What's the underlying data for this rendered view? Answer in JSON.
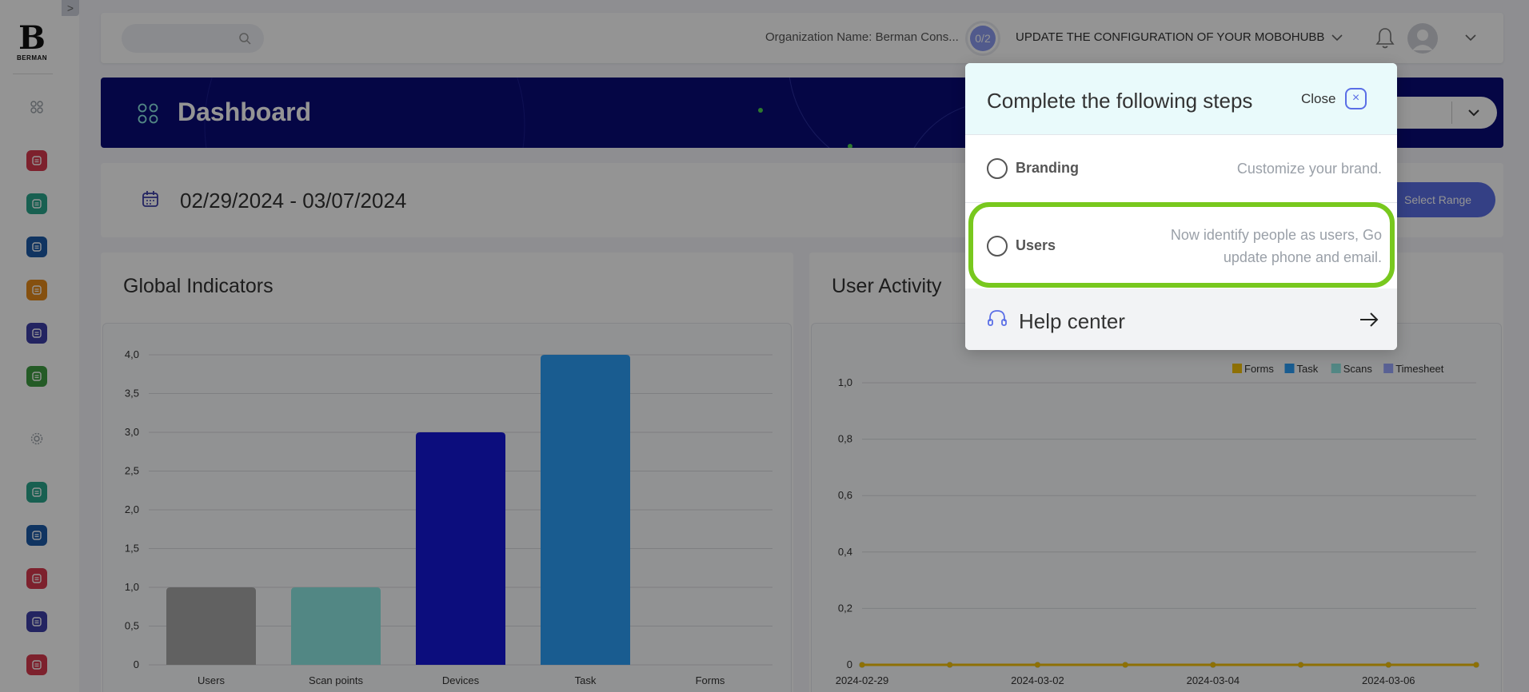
{
  "sidebar": {
    "logo_text": "BERMAN",
    "toggle_glyph": ">",
    "icons": [
      {
        "name": "dashboard-grid-icon",
        "color": "#9aa0a8"
      },
      {
        "name": "scan-icon",
        "color": "#d83a4e"
      },
      {
        "name": "location-pin-icon",
        "color": "#2aa58c"
      },
      {
        "name": "document-list-icon",
        "color": "#1d5aa8"
      },
      {
        "name": "alert-icon",
        "color": "#e58a1a"
      },
      {
        "name": "tablet-device-icon",
        "color": "#3d3ea8"
      },
      {
        "name": "map-icon",
        "color": "#3e9e42"
      },
      {
        "name": "settings-gear-icon",
        "color": "#9aa0a8"
      },
      {
        "name": "shield-icon",
        "color": "#2aa58c"
      },
      {
        "name": "cast-screen-icon",
        "color": "#1d5aa8"
      },
      {
        "name": "users-group-icon",
        "color": "#d83a4e"
      },
      {
        "name": "gallery-icon",
        "color": "#3d3ea8"
      },
      {
        "name": "form-list-icon",
        "color": "#d83a4e"
      }
    ]
  },
  "topbar": {
    "search_placeholder": "",
    "organization": "Organization Name: Berman Cons...",
    "progress_badge": "0/2",
    "update_text": "UPDATE THE CONFIGURATION OF YOUR MOBOHUBB"
  },
  "banner": {
    "title": "Dashboard"
  },
  "datebar": {
    "range": "02/29/2024 - 03/07/2024",
    "select_range_label": "Select Range"
  },
  "global_indicators": {
    "title": "Global Indicators"
  },
  "user_activity": {
    "title": "User Activity"
  },
  "chart_data": [
    {
      "type": "bar",
      "title": "Global Indicators",
      "categories": [
        "Users",
        "Scan points",
        "Devices",
        "Task",
        "Forms"
      ],
      "values": [
        1,
        1,
        3,
        4,
        0
      ],
      "colors": [
        "#a8a8a8",
        "#8ee8e4",
        "#1618d8",
        "#2b9ff8",
        "#cccccc"
      ],
      "ylim": [
        0,
        4
      ],
      "yticks": [
        "0",
        "0,5",
        "1,0",
        "1,5",
        "2,0",
        "2,5",
        "3,0",
        "3,5",
        "4,0"
      ],
      "grid": true
    },
    {
      "type": "line",
      "title": "User Activity",
      "x": [
        "2024-02-29",
        "2024-03-01",
        "2024-03-02",
        "2024-03-03",
        "2024-03-04",
        "2024-03-05",
        "2024-03-06",
        "2024-03-07"
      ],
      "xtick_labels": [
        "2024-02-29",
        "2024-03-02",
        "2024-03-04",
        "2024-03-06"
      ],
      "series": [
        {
          "name": "Forms",
          "color": "#f5c20a",
          "values": [
            0,
            0,
            0,
            0,
            0,
            0,
            0,
            0
          ]
        },
        {
          "name": "Task",
          "color": "#2b9ff8",
          "values": [
            0,
            0,
            0,
            0,
            0,
            0,
            0,
            0
          ]
        },
        {
          "name": "Scans",
          "color": "#8ee8e4",
          "values": [
            0,
            0,
            0,
            0,
            0,
            0,
            0,
            0
          ]
        },
        {
          "name": "Timesheet",
          "color": "#9aa8ff",
          "values": [
            0,
            0,
            0,
            0,
            0,
            0,
            0,
            0
          ]
        }
      ],
      "ylim": [
        0,
        1
      ],
      "yticks": [
        "0",
        "0,2",
        "0,4",
        "0,6",
        "0,8",
        "1,0"
      ],
      "legend": "top-right",
      "grid": true
    }
  ],
  "popup": {
    "title": "Complete the following steps",
    "close_label": "Close",
    "close_glyph": "×",
    "steps": [
      {
        "label": "Branding",
        "description": "Customize your brand."
      },
      {
        "label": "Users",
        "description_line1": "Now identify people as users, Go",
        "description_line2": "update phone and email."
      }
    ],
    "help_label": "Help center"
  }
}
